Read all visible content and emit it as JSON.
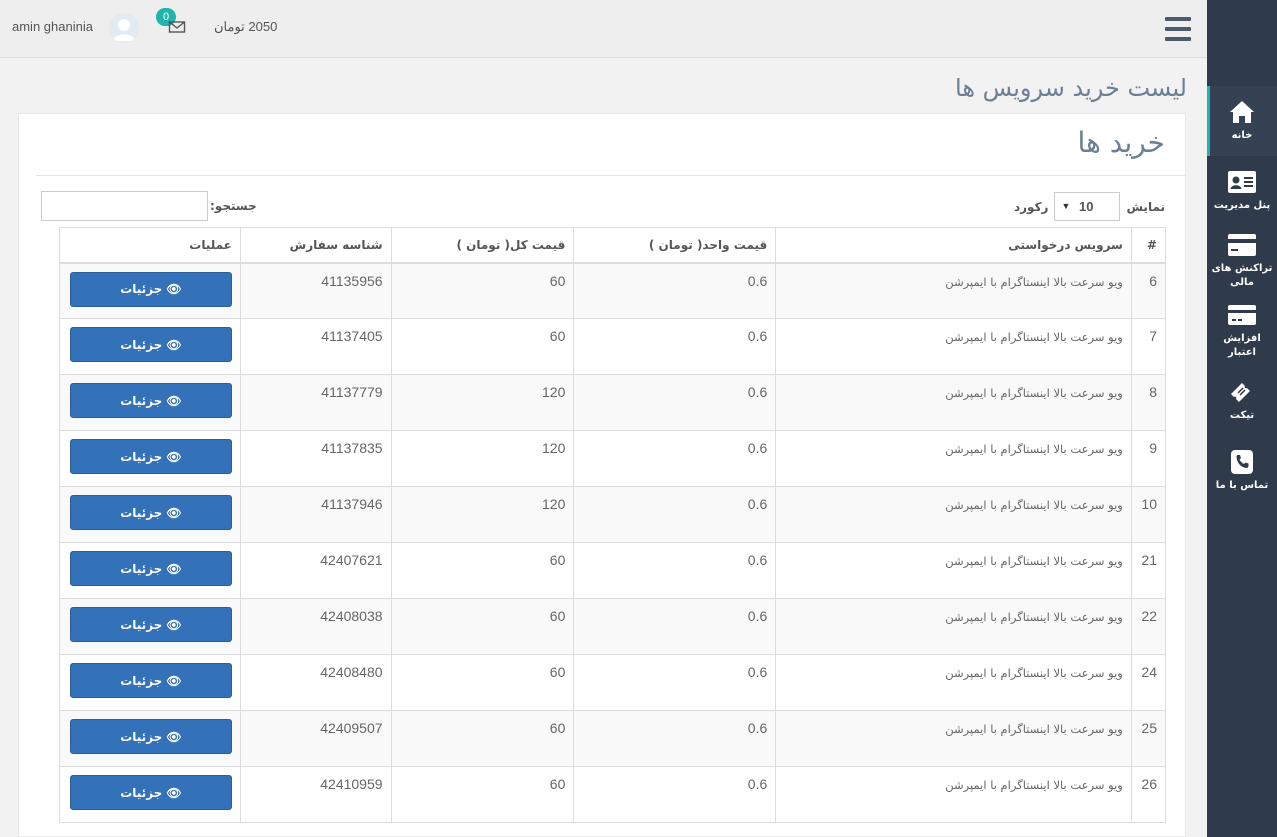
{
  "header": {
    "user_name": "amin ghaninia",
    "notification_count": "0",
    "balance": "2050 تومان"
  },
  "sidebar": {
    "items": [
      {
        "label": "خانه",
        "icon": "home-icon"
      },
      {
        "label": "پنل مدیریت",
        "icon": "id-card-icon"
      },
      {
        "label": "تراکنش های مالی",
        "icon": "credit-card-icon"
      },
      {
        "label": "افزایش اعتبار",
        "icon": "card-plus-icon"
      },
      {
        "label": "تیکت",
        "icon": "ticket-icon"
      },
      {
        "label": "تماس با ما",
        "icon": "phone-icon"
      }
    ]
  },
  "page": {
    "title": "لیست خرید سرویس ها",
    "card_title": "خرید ها",
    "show_label": "نمایش",
    "records_label": "رکورد",
    "page_size": "10",
    "search_label": "جستجو:"
  },
  "table": {
    "headers": [
      "#",
      "سرویس درخواستی",
      "قیمت واحد( تومان )",
      "قیمت کل( تومان )",
      "شناسه سفارش",
      "عملیات"
    ],
    "button_label": "جزئیات",
    "rows": [
      {
        "num": "6",
        "service": "ویو سرعت بالا اینستاگرام با ایمپرشن",
        "unit": "0.6",
        "total": "60",
        "order_id": "41135956"
      },
      {
        "num": "7",
        "service": "ویو سرعت بالا اینستاگرام با ایمپرشن",
        "unit": "0.6",
        "total": "60",
        "order_id": "41137405"
      },
      {
        "num": "8",
        "service": "ویو سرعت بالا اینستاگرام با ایمپرشن",
        "unit": "0.6",
        "total": "120",
        "order_id": "41137779"
      },
      {
        "num": "9",
        "service": "ویو سرعت بالا اینستاگرام با ایمپرشن",
        "unit": "0.6",
        "total": "120",
        "order_id": "41137835"
      },
      {
        "num": "10",
        "service": "ویو سرعت بالا اینستاگرام با ایمپرشن",
        "unit": "0.6",
        "total": "120",
        "order_id": "41137946"
      },
      {
        "num": "21",
        "service": "ویو سرعت بالا اینستاگرام با ایمپرشن",
        "unit": "0.6",
        "total": "60",
        "order_id": "42407621"
      },
      {
        "num": "22",
        "service": "ویو سرعت بالا اینستاگرام با ایمپرشن",
        "unit": "0.6",
        "total": "60",
        "order_id": "42408038"
      },
      {
        "num": "24",
        "service": "ویو سرعت بالا اینستاگرام با ایمپرشن",
        "unit": "0.6",
        "total": "60",
        "order_id": "42408480"
      },
      {
        "num": "25",
        "service": "ویو سرعت بالا اینستاگرام با ایمپرشن",
        "unit": "0.6",
        "total": "60",
        "order_id": "42409507"
      },
      {
        "num": "26",
        "service": "ویو سرعت بالا اینستاگرام با ایمپرشن",
        "unit": "0.6",
        "total": "60",
        "order_id": "42410959"
      }
    ]
  },
  "colors": {
    "sidebar_bg": "#2f3a4a",
    "accent": "#1fb5ac",
    "button": "#3372b8",
    "title": "#6b7f95"
  }
}
